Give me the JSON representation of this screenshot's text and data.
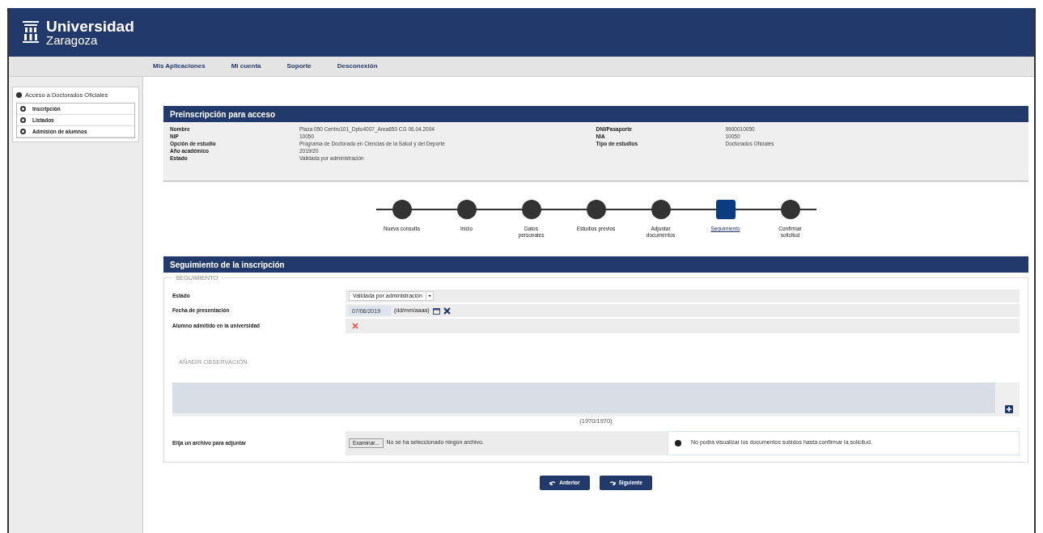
{
  "header": {
    "logo_title": "Universidad",
    "logo_subtitle": "Zaragoza"
  },
  "nav": [
    "Mis Aplicaciones",
    "Mi cuenta",
    "Soporte",
    "Desconexión"
  ],
  "sidebar": {
    "title": "Acceso a Doctorados Oficiales",
    "items": [
      {
        "label": "Inscripción"
      },
      {
        "label": "Listados"
      },
      {
        "label": "Admisión de alumnos"
      }
    ]
  },
  "preinscripcion": {
    "title": "Preinscripción para acceso",
    "left": [
      {
        "label": "Nombre",
        "value": "Plaza 050 Centro101_Dpto4007_Area650 CG 06.04.2004"
      },
      {
        "label": "NIP",
        "value": "10050"
      },
      {
        "label": "Opción de estudio",
        "value": "Programa de Doctorado en Ciencias de la Salud y del Deporte"
      },
      {
        "label": "Año académico",
        "value": "2019/20"
      },
      {
        "label": "Estado",
        "value": "Validada por administración"
      }
    ],
    "right": [
      {
        "label": "DNI/Pasaporte",
        "value": "9900010050"
      },
      {
        "label": "NIA",
        "value": "10050"
      },
      {
        "label": "Tipo de estudios",
        "value": "Doctorados Oficiales"
      }
    ]
  },
  "steps": [
    {
      "label": "Nueva consulta",
      "selected": false
    },
    {
      "label": "Inicio",
      "selected": false
    },
    {
      "label": "Datos personales",
      "selected": false
    },
    {
      "label": "Estudios previos",
      "selected": false
    },
    {
      "label": "Adjuntar documentos",
      "selected": false
    },
    {
      "label": "Seguimiento",
      "selected": true
    },
    {
      "label": "Confirmar solicitud",
      "selected": false
    }
  ],
  "seguimiento": {
    "title": "Seguimiento de la inscripción",
    "legend": "SEGUIMIENTO",
    "estado_label": "Estado",
    "estado_value": "Validada por administración",
    "fecha_label": "Fecha de presentación",
    "fecha_value": "07/06/2019",
    "fecha_hint": "(dd/mm/aaaa)",
    "admitido_label": "Alumno admitido en la universidad",
    "admitido": false,
    "observacion_title": "AÑADIR OBSERVACIÓN",
    "counter": "(1970/1970)",
    "archivo_label": "Elija un archivo para adjuntar",
    "browse_button": "Examinar...",
    "no_file": "No se ha seleccionado ningún archivo.",
    "info": "No podrá visualizar los documentos subidos hasta confirmar la solicitud."
  },
  "buttons": [
    "Anterior",
    "Siguiente"
  ]
}
